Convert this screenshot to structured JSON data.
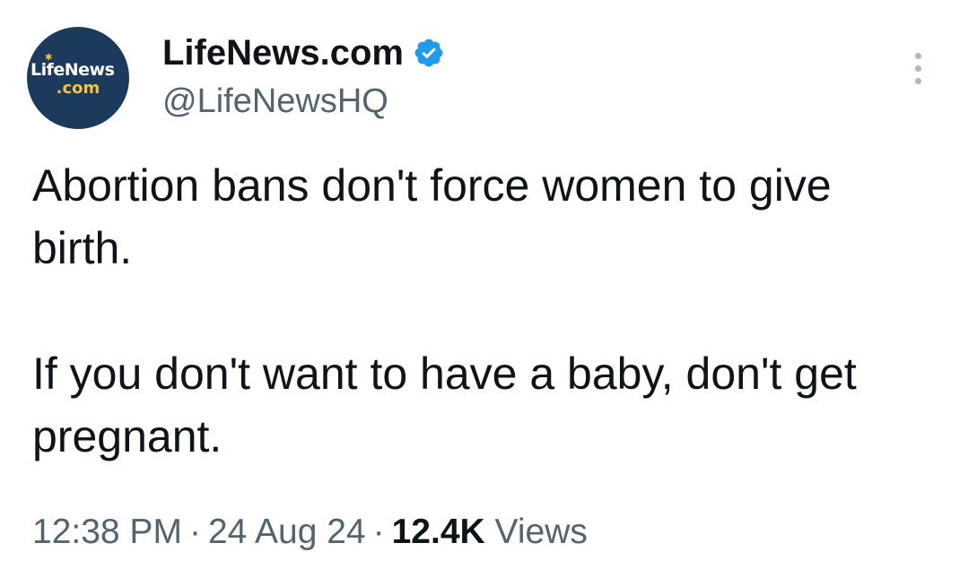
{
  "avatar": {
    "brand_text": "LifeNews",
    "brand_suffix": ".com",
    "background_color": "#1b3a5c",
    "accent_color": "#f6c23e"
  },
  "author": {
    "display_name": "LifeNews.com",
    "handle": "@LifeNewsHQ",
    "verified": true,
    "verified_icon": "verified-badge-icon",
    "verified_color": "#1d9bf0"
  },
  "menu": {
    "icon": "more-options-icon"
  },
  "tweet": {
    "paragraphs": [
      "Abortion bans don't force women to give birth.",
      "If you don't want to have a baby, don't get pregnant."
    ]
  },
  "meta": {
    "time": "12:38 PM",
    "separator": "·",
    "date": "24 Aug 24",
    "views_count": "12.4K",
    "views_label": "Views"
  },
  "colors": {
    "text_primary": "#0f1419",
    "text_secondary": "#536471"
  }
}
